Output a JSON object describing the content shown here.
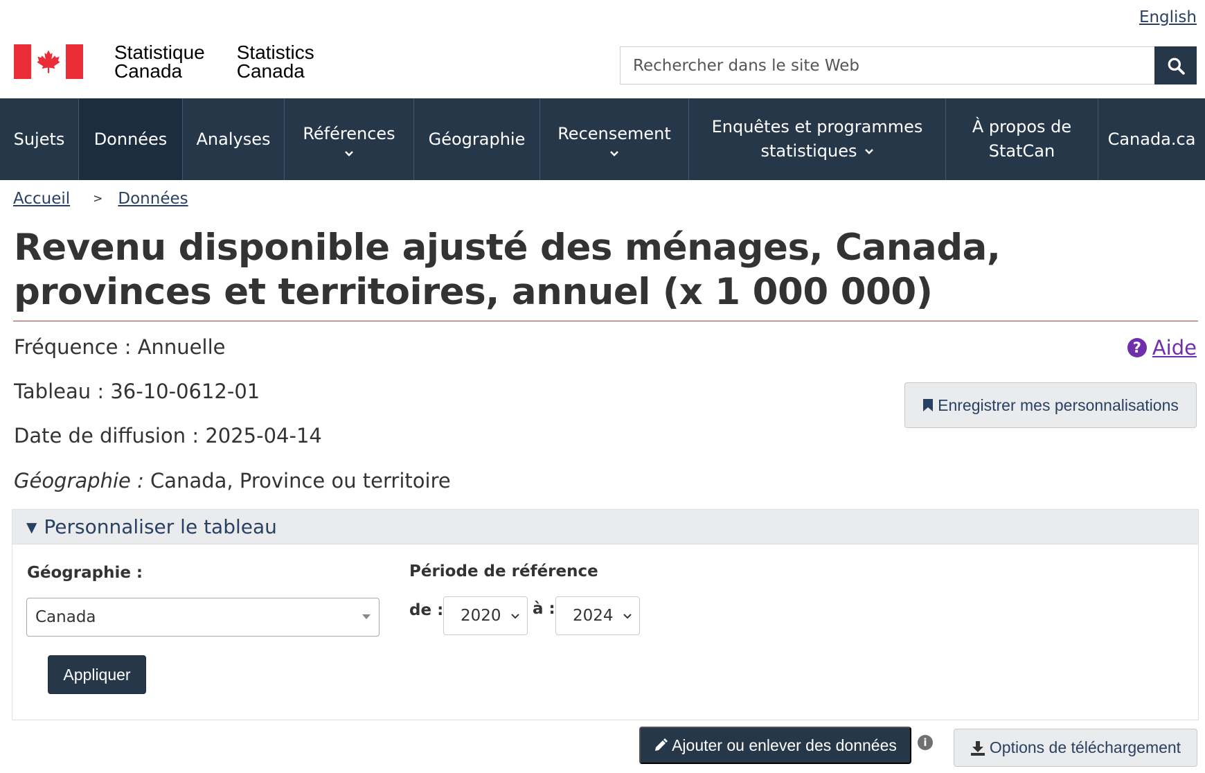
{
  "header": {
    "language_link": "English",
    "logo": {
      "fr_text": "Statistique\nCanada",
      "en_text": "Statistics\nCanada",
      "flag_color": "#eb2d37"
    },
    "search": {
      "placeholder": "Rechercher dans le site Web",
      "button_icon": "search-icon"
    }
  },
  "nav": {
    "items": [
      {
        "label": "Sujets",
        "has_dropdown": false
      },
      {
        "label": "Données",
        "has_dropdown": false,
        "active": true
      },
      {
        "label": "Analyses",
        "has_dropdown": false
      },
      {
        "label": "Références",
        "has_dropdown": true
      },
      {
        "label": "Géographie",
        "has_dropdown": false
      },
      {
        "label": "Recensement",
        "has_dropdown": true
      },
      {
        "label": "Enquêtes et programmes",
        "label_line2": "statistiques",
        "has_dropdown": true
      },
      {
        "label": "À propos de",
        "label_line2": "StatCan",
        "has_dropdown": false
      },
      {
        "label": "Canada.ca",
        "has_dropdown": false
      }
    ],
    "chevron": "⌄",
    "background": "#26374a"
  },
  "breadcrumb": {
    "items": [
      "Accueil",
      "Données"
    ],
    "separator": ">"
  },
  "page": {
    "title": "Revenu disponible ajusté des ménages, Canada, provinces et territoires, annuel (x 1 000 000)",
    "frequency": "Fréquence : Annuelle",
    "table": "Tableau : 36-10-0612-01",
    "release_date": "Date de diffusion : 2025-04-14",
    "geography_label": "Géographie :",
    "geography_value": " Canada, Province ou territoire",
    "help_label": "Aide",
    "save_button": "Enregistrer mes personnalisations"
  },
  "customize": {
    "heading": "Personnaliser le tableau",
    "geography_label": "Géographie :",
    "geography_value": "Canada",
    "period_label": "Période de référence",
    "from_label": "de :",
    "from_value": "2020",
    "to_label": "à :",
    "to_value": "2024",
    "apply_button": "Appliquer"
  },
  "actions": {
    "add_remove_button": "Ajouter ou enlever des données",
    "info_icon": "i",
    "download_button": "Options de téléchargement"
  },
  "colors": {
    "accent": "#26374a",
    "link": "#284162",
    "help": "#6f2fad",
    "rule": "#af3c43"
  }
}
